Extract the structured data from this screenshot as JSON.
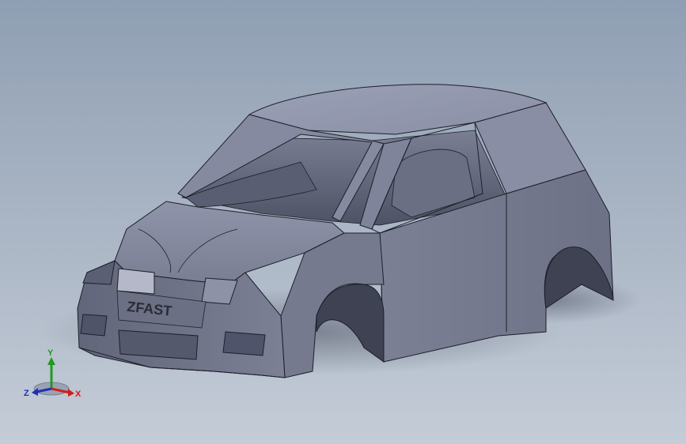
{
  "viewport": {
    "background_top": "#8f9fb3",
    "background_bottom": "#c4ccd7"
  },
  "model": {
    "badge_text": "ZFAST",
    "body_color": "#7e8296",
    "edge_color": "#1d1f28"
  },
  "triad": {
    "x_label": "X",
    "y_label": "Y",
    "z_label": "Z",
    "x_color": "#d0201e",
    "y_color": "#1f9a24",
    "z_color": "#2030b8"
  }
}
